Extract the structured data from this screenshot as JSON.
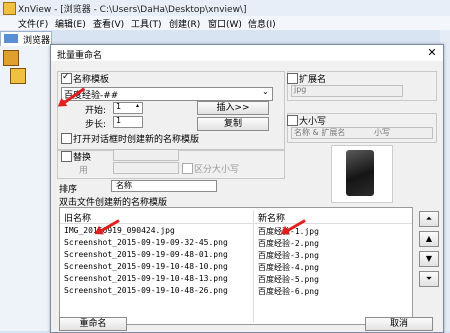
{
  "window": {
    "title": "XnView - [浏览器 - C:\\Users\\DaHa\\Desktop\\xnview\\]"
  },
  "menu": [
    "文件(F)",
    "编辑(E)",
    "查看(V)",
    "工具(T)",
    "创建(R)",
    "窗口(W)",
    "信息(I)"
  ],
  "browser_tab": "浏览器",
  "dialog": {
    "title": "批量重命名",
    "name_template": {
      "checkbox_label": "名称模板",
      "checked": true,
      "value": "百度经验-##"
    },
    "start_label": "开始:",
    "start_value": "1",
    "step_label": "步长:",
    "step_value": "1",
    "insert_button": "插入>>",
    "copy_button": "复制",
    "open_dialog_label": "打开对话框时创建新的名称模版",
    "replace": {
      "label": "替换",
      "with_label": "用",
      "case_label": "区分大小写"
    },
    "extension": {
      "label": "扩展名",
      "value": "jpg"
    },
    "case_group": {
      "label": "大小写",
      "select_value": "名称 & 扩展名",
      "case_value": "小写"
    },
    "sort_label": "排序",
    "sort_value": "名称",
    "list_caption": "双击文件创建新的名称模版",
    "list_headers": {
      "old": "旧名称",
      "new": "新名称"
    },
    "files": [
      {
        "old": "IMG_20150919_090424.jpg",
        "new": "百度经验-1.jpg"
      },
      {
        "old": "Screenshot_2015-09-19-09-32-45.png",
        "new": "百度经验-2.png"
      },
      {
        "old": "Screenshot_2015-09-19-09-48-01.png",
        "new": "百度经验-3.png"
      },
      {
        "old": "Screenshot_2015-09-19-10-48-10.png",
        "new": "百度经验-4.png"
      },
      {
        "old": "Screenshot_2015-09-19-10-48-13.png",
        "new": "百度经验-5.png"
      },
      {
        "old": "Screenshot_2015-09-19-10-48-26.png",
        "new": "百度经验-6.png"
      }
    ],
    "rename_button": "重命名",
    "cancel_button": "取消"
  },
  "colors": {
    "arrow": "#e02020",
    "titlebar": "#e8eef7"
  },
  "icons": [
    "app-icon",
    "close-icon",
    "move-top-icon",
    "move-up-icon",
    "move-down-icon",
    "move-bottom-icon",
    "dropdown-arrow-icon"
  ]
}
